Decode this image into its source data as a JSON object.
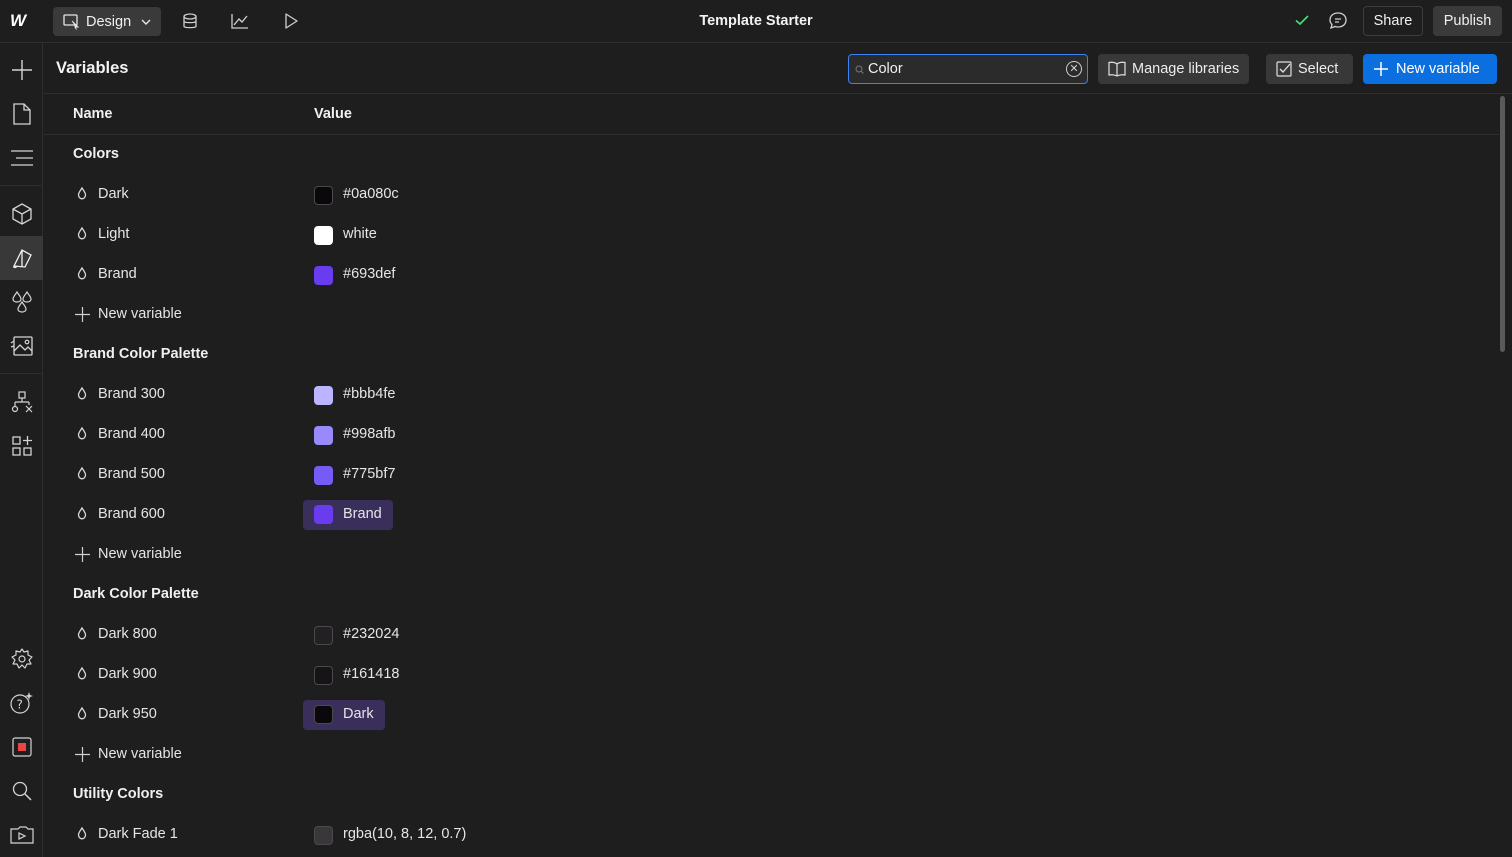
{
  "topbar": {
    "logo": "W",
    "mode_label": "Design",
    "title": "Template Starter",
    "share_label": "Share",
    "publish_label": "Publish"
  },
  "panel": {
    "title": "Variables",
    "search": {
      "value": "Color",
      "placeholder": ""
    },
    "manage_libraries_label": "Manage libraries",
    "select_label": "Select",
    "new_variable_label": "New variable",
    "columns": {
      "name": "Name",
      "value": "Value"
    }
  },
  "groups": [
    {
      "title": "Colors",
      "items": [
        {
          "name": "Dark",
          "value": "#0a080c",
          "swatch": "#0a080c",
          "alias": false
        },
        {
          "name": "Light",
          "value": "white",
          "swatch": "#ffffff",
          "alias": false
        },
        {
          "name": "Brand",
          "value": "#693def",
          "swatch": "#693def",
          "alias": false
        }
      ],
      "new_label": "New variable"
    },
    {
      "title": "Brand Color Palette",
      "items": [
        {
          "name": "Brand 300",
          "value": "#bbb4fe",
          "swatch": "#bbb4fe",
          "alias": false
        },
        {
          "name": "Brand 400",
          "value": "#998afb",
          "swatch": "#998afb",
          "alias": false
        },
        {
          "name": "Brand 500",
          "value": "#775bf7",
          "swatch": "#775bf7",
          "alias": false
        },
        {
          "name": "Brand 600",
          "value": "Brand",
          "swatch": "#693def",
          "alias": true
        }
      ],
      "new_label": "New variable"
    },
    {
      "title": "Dark Color Palette",
      "items": [
        {
          "name": "Dark 800",
          "value": "#232024",
          "swatch": "#232024",
          "alias": false
        },
        {
          "name": "Dark 900",
          "value": "#161418",
          "swatch": "#161418",
          "alias": false
        },
        {
          "name": "Dark 950",
          "value": "Dark",
          "swatch": "#0a080c",
          "alias": true
        }
      ],
      "new_label": "New variable"
    },
    {
      "title": "Utility Colors",
      "items": [
        {
          "name": "Dark Fade 1",
          "value": "rgba(10, 8, 12, 0.7)",
          "swatch": "#3a373c",
          "alias": false
        }
      ],
      "new_label": ""
    }
  ],
  "colors": {
    "accent": "#0b6fe0",
    "alias_pill": "#3a2f5a",
    "background": "#1e1e1e",
    "success": "#4ade80"
  },
  "icons": {
    "rail": [
      "plus-icon",
      "page-icon",
      "navigator-icon",
      "component-icon",
      "style-manager-icon",
      "variables-icon",
      "assets-icon",
      "logic-icon",
      "apps-icon",
      "settings-icon",
      "help-icon",
      "stop-icon",
      "search-icon",
      "video-icon"
    ]
  }
}
